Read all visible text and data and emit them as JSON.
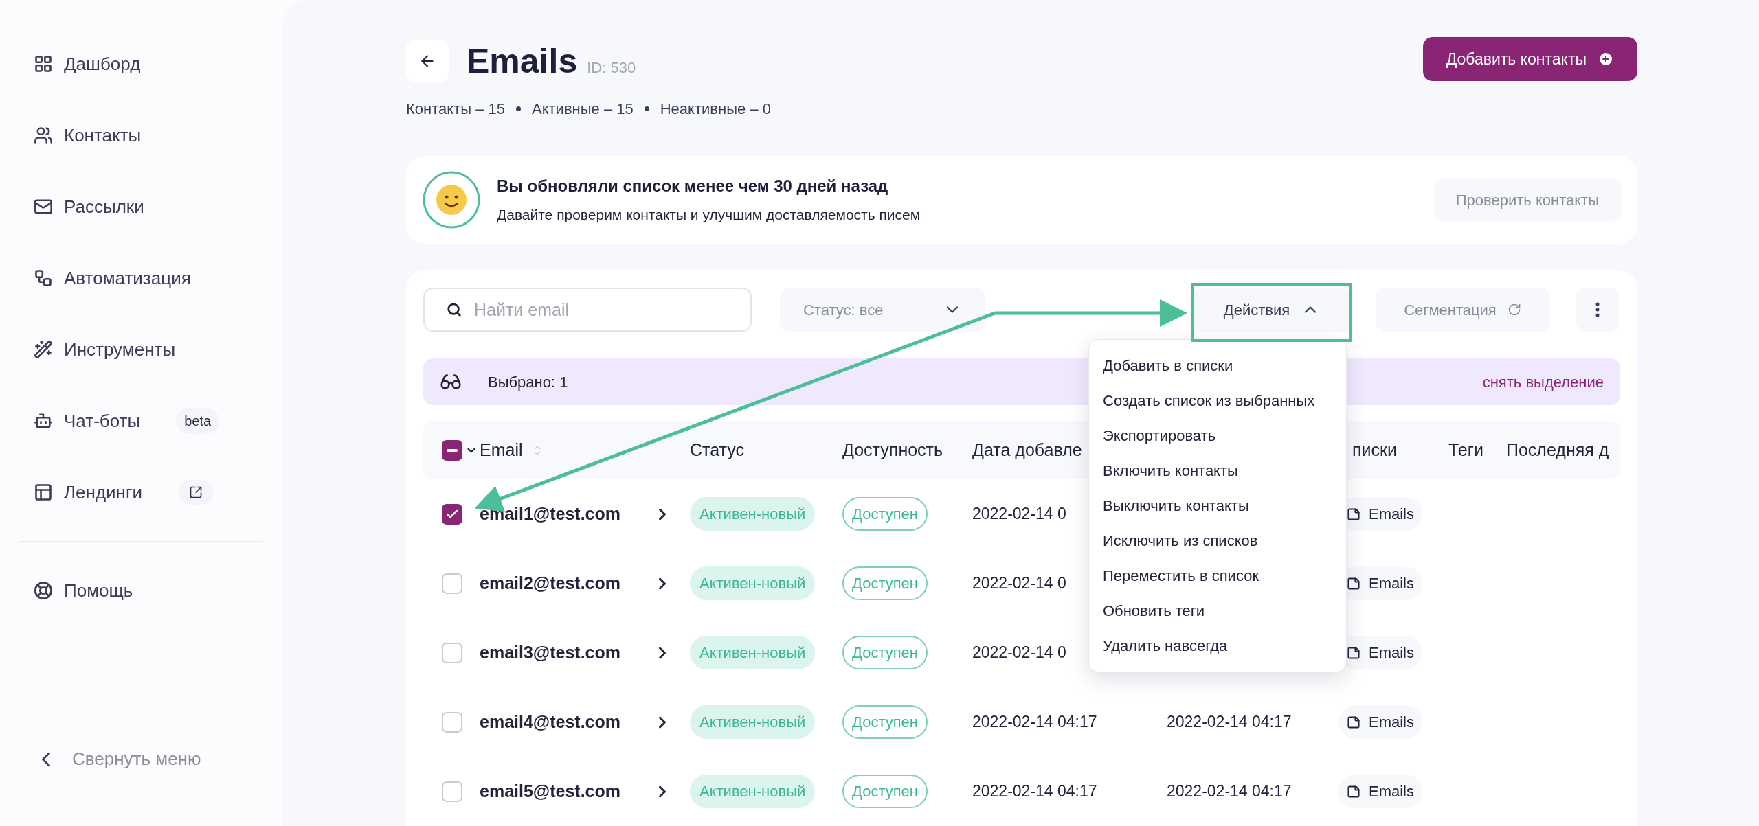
{
  "sidebar": {
    "items": [
      {
        "label": "Дашборд",
        "kind": "plain"
      },
      {
        "label": "Контакты",
        "kind": "plain"
      },
      {
        "label": "Рассылки",
        "kind": "plain"
      },
      {
        "label": "Автоматизация",
        "kind": "plain"
      },
      {
        "label": "Инструменты",
        "kind": "plain"
      },
      {
        "label": "Чат-боты",
        "kind": "badge",
        "badge": "beta"
      },
      {
        "label": "Лендинги",
        "kind": "external"
      }
    ],
    "footer_items": [
      {
        "label": "Помощь"
      }
    ],
    "collapse": {
      "label": "Свернуть меню"
    }
  },
  "header": {
    "title": "Emails",
    "id": "ID: 530",
    "add_button": "Добавить контакты",
    "stats": [
      "Контакты – 15",
      "Активные – 15",
      "Неактивные – 0"
    ]
  },
  "banner": {
    "title": "Вы обновляли список менее чем 30 дней назад",
    "text": "Давайте проверим контакты и улучшим доставляемость писем",
    "button": "Проверить контакты"
  },
  "toolbar": {
    "search": {
      "placeholder": "Найти email"
    },
    "status_filter": "Статус: все",
    "actions": {
      "label": "Действия",
      "expanded": true,
      "menu": [
        "Добавить в списки",
        "Создать список из выбранных",
        "Экспортировать",
        "Включить контакты",
        "Выключить контакты",
        "Исключить из списков",
        "Переместить в список",
        "Обновить теги",
        "Удалить навсегда"
      ]
    },
    "segmentation": "Сегментация"
  },
  "selection": {
    "label": "Выбрано: 1",
    "clear": "снять выделение"
  },
  "table": {
    "select_all": {
      "indeterminate": true
    },
    "columns": [
      {
        "label": "Email",
        "sortable": true
      },
      {
        "label": "Статус",
        "sortable": false
      },
      {
        "label": "Доступность",
        "sortable": false
      },
      {
        "label": "Дата добавле",
        "sortable": false
      },
      {
        "label": "писки",
        "sortable": false
      },
      {
        "label": "Теги",
        "sortable": false
      },
      {
        "label": "Последняя д",
        "sortable": false
      }
    ],
    "rows": [
      {
        "checked": true,
        "email": "email1@test.com",
        "status": "Активен-новый",
        "availability": "Доступен",
        "date_1": "2022-02-14 0",
        "list": "Emails"
      },
      {
        "checked": false,
        "email": "email2@test.com",
        "status": "Активен-новый",
        "availability": "Доступен",
        "date_1": "2022-02-14 0",
        "list": "Emails"
      },
      {
        "checked": false,
        "email": "email3@test.com",
        "status": "Активен-новый",
        "availability": "Доступен",
        "date_1": "2022-02-14 0",
        "list": "Emails"
      },
      {
        "checked": false,
        "email": "email4@test.com",
        "status": "Активен-новый",
        "availability": "Доступен",
        "date_1": "2022-02-14 04:17",
        "date_2": "2022-02-14 04:17",
        "list": "Emails"
      },
      {
        "checked": false,
        "email": "email5@test.com",
        "status": "Активен-новый",
        "availability": "Доступен",
        "date_1": "2022-02-14 04:17",
        "date_2": "2022-02-14 04:17",
        "list": "Emails"
      }
    ]
  }
}
